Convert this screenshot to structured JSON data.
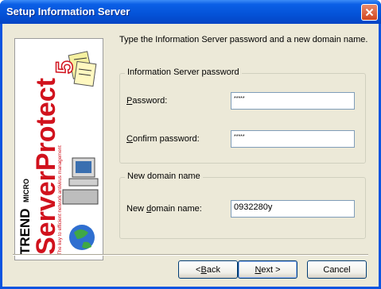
{
  "window": {
    "title": "Setup Information Server"
  },
  "sidebar": {
    "brand": "TREND",
    "brand_sub": "MICRO",
    "product": "ServerProtect",
    "version": "5",
    "tagline": "The key to efficient network antivirus management"
  },
  "instructions": "Type the Information Server password and a new domain name.",
  "password_group": {
    "title": "Information Server password",
    "password_label_u": "P",
    "password_label_rest": "assword:",
    "password_value": "*****",
    "confirm_label_u": "C",
    "confirm_label_rest": "onfirm password:",
    "confirm_value": "*****"
  },
  "domain_group": {
    "title": "New domain name",
    "label_pre": "New ",
    "label_u": "d",
    "label_rest": "omain name:",
    "value": "0932280y"
  },
  "buttons": {
    "back_pre": "< ",
    "back_u": "B",
    "back_rest": "ack",
    "next_u": "N",
    "next_rest": "ext >",
    "cancel": "Cancel"
  },
  "colors": {
    "title_bar": "#0a54e0",
    "close": "#d2461f",
    "face": "#ece9d8",
    "brand_red": "#d1121d"
  }
}
